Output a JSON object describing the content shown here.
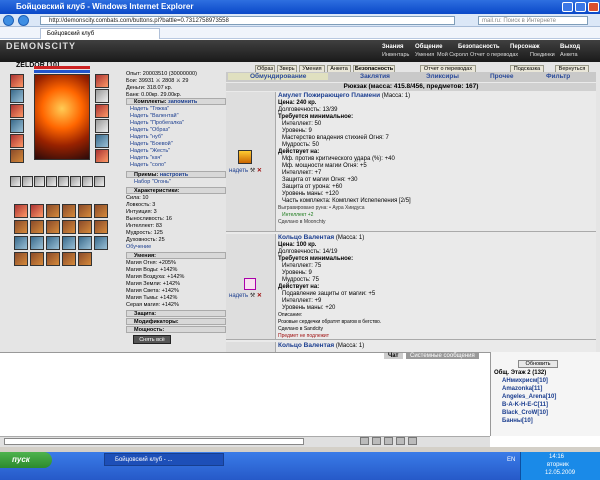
{
  "window": {
    "title": "Бойцовский клуб - Windows Internet Explorer"
  },
  "browser": {
    "url": "http://demonscity.combats.com/buttons.pl?battle=0.7312758973558",
    "search_placeholder": "mail.ru: Поиск в Интернете",
    "tab": "Бойцовский клуб"
  },
  "game": {
    "logo": "DEMONSCITY",
    "menu_top": [
      "Знания",
      "Общение",
      "Безопасность",
      "Персонаж",
      "Выход"
    ],
    "menu_bottom": [
      "Инвентарь",
      "Умения",
      "Мой Скролл",
      "Отчет о переводах",
      "Поединки",
      "Анкета"
    ],
    "nav": [
      "Образ",
      "Зверь",
      "Умения",
      "Анкета",
      "Безопасность",
      "Отчет о переводах",
      "Подсказка",
      "Вернуться"
    ]
  },
  "character": {
    "name": "ZELDOR",
    "level": "[10]",
    "exp": "Опыт: 20003510 (30000000)",
    "wins": "Бои: 39931 ⚔ 2808 ⚔ 29",
    "money": "Деньги: 318.07 кр.",
    "bank": "Банк: 0.00кр. 29.00кр.",
    "sets_header": "Комплекты:",
    "sets_action": "запомнить",
    "sets": [
      "Надеть \"Тяжка\"",
      "Надеть \"Валентай\"",
      "Надеть \"Пробегалка\"",
      "Надеть \"Образ\"",
      "Надеть \"нуб\"",
      "Надеть \"Боевой\"",
      "Надеть \"Жесть\"",
      "Надеть \"кач\"",
      "Надеть \"соло\""
    ],
    "receptions_header": "Приемы:",
    "receptions_action": "настроить",
    "receptions_set": "Набор \"Огонь\"",
    "stats_header": "Характеристики:",
    "stats": [
      "Сила: 10",
      "Ловкость: 3",
      "Интуиция: 3",
      "Выносливость: 16",
      "Интеллект: 83",
      "Мудрость: 125",
      "Духовность: 25"
    ],
    "training": "Обучение",
    "skills_header": "Умения:",
    "skills": [
      "Магия Огня: +205%",
      "Магия Воды: +142%",
      "Магия Воздуха: +142%",
      "Магия Земли: +142%",
      "Магия Света: +142%",
      "Магия Тьмы: +142%",
      "Серая магия: +142%"
    ],
    "protect_header": "Защита:",
    "modifiers_header": "Модификаторы:",
    "power_header": "Мощность:",
    "remove_all": "Снять всё"
  },
  "inventory": {
    "tabs": [
      "Обмундирование",
      "Заклятия",
      "Эликсиры",
      "Прочее",
      "Фильтр"
    ],
    "summary": "Рюкзак (масса: 415.8/456, предметов: 167)",
    "wear_label": "надеть",
    "items": [
      {
        "name": "Амулет Пожирающего Пламени",
        "mass": "(Масса: 1)",
        "price": "Цена: 240 кр.",
        "durability": "Долговечность: 13/39",
        "req_title": "Требуется минимальное:",
        "reqs": [
          "Интеллект: 50",
          "Уровень: 9",
          "Мастерство владения стихией Огня: 7",
          "Мудрость: 50"
        ],
        "acts_title": "Действует на:",
        "acts": [
          "Мф. против критического удара (%): +40",
          "Мф. мощности магии Огня: +5",
          "Интеллект: +7",
          "Защита от магии Огня: +30",
          "Защита от урона: +60",
          "Уровень маны: +120",
          "Часть комплекта: Комплект Испепеления [2/5]"
        ],
        "extra": "Выгравировано руна: • Аура Хиидуса",
        "extra2": "Интеллект +2",
        "made": "Сделано в Moonchty"
      },
      {
        "name": "Кольцо Валентая",
        "mass": "(Масса: 1)",
        "price": "Цена: 100 кр.",
        "durability": "Долговечность: 14/19",
        "req_title": "Требуется минимальное:",
        "reqs": [
          "Интеллект: 75",
          "Уровень: 9",
          "Мудрость: 75"
        ],
        "acts_title": "Действует на:",
        "acts": [
          "Подавление защиты от магии: +5",
          "Интеллект: +9",
          "Уровень маны: +20"
        ],
        "extra": "Описание:",
        "extra2": "Розовые сердечки обратят врагов в бегство.",
        "made": "Сделано в Sandcity",
        "made2": "Предмет не подлежит"
      },
      {
        "name": "Кольцо Валентая",
        "mass": "(Масса: 1)"
      }
    ]
  },
  "chat": {
    "tabs": [
      "Чат",
      "Системные сообщения"
    ]
  },
  "online": {
    "refresh": "Обновить",
    "header": "Общ. Этаж 2 (132)",
    "users": [
      "АНмихрисм[10]",
      "Amazonka[11]",
      "Angeles_Arena[10]",
      "B-A-K-H-E-C[11]",
      "Black_CroW[10]",
      "Банны[10]"
    ]
  },
  "taskbar": {
    "start": "пуск",
    "task": "Бойцовский клуб - ...",
    "lang": "EN",
    "time": "14:16",
    "day": "вторник",
    "date": "12.05.2009"
  }
}
